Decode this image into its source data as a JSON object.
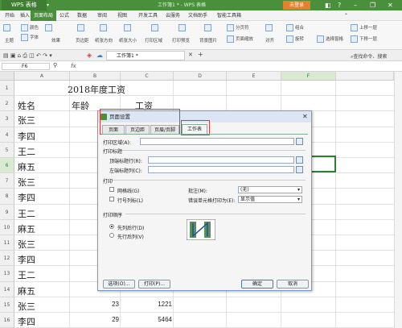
{
  "app": {
    "brand": "WPS 表格",
    "window_title": "工作簿1 * - WPS 表格",
    "login_button": "未登录"
  },
  "menu": [
    "开始",
    "插入",
    "页面布局",
    "公式",
    "数据",
    "审阅",
    "视图",
    "开发工具",
    "云服务",
    "文档助手",
    "智能工具箱"
  ],
  "menu_active_index": 2,
  "ribbon": {
    "items": [
      "主题",
      "颜色",
      "字体",
      "效果",
      "页边距",
      "纸张方向",
      "纸张大小",
      "打印区域",
      "打印预览",
      "背景图片",
      "分页符",
      "页面缩放",
      "对齐",
      "旋转",
      "组合",
      "选择窗格",
      "上移一层",
      "下移一层"
    ]
  },
  "doc_tab": "工作簿1 *",
  "search_placeholder": "查找命令、搜索",
  "formula_bar": {
    "cell_ref": "F6",
    "fx": "fx"
  },
  "columns": [
    "A",
    "B",
    "C",
    "D",
    "E",
    "F"
  ],
  "rows": [
    "1",
    "2",
    "3",
    "4",
    "5",
    "6",
    "7",
    "8",
    "9",
    "10",
    "11",
    "12",
    "13",
    "14",
    "15",
    "16"
  ],
  "sheet": {
    "title": "2018年度工资",
    "headers": [
      "姓名",
      "年龄",
      "工资"
    ],
    "names": [
      "张三",
      "李四",
      "王二",
      "麻五",
      "张三",
      "李四",
      "王二",
      "麻五",
      "张三",
      "李四",
      "王二",
      "麻五",
      "张三",
      "李四"
    ],
    "ages": [
      "23",
      "29"
    ],
    "salaries": [
      "1221",
      "5464"
    ]
  },
  "dialog": {
    "title": "页面设置",
    "tabs": [
      "页面",
      "页边距",
      "页眉/页脚",
      "工作表"
    ],
    "print_area_label": "打印区域(A):",
    "print_titles_label": "打印标题",
    "top_rows_label": "顶端标题行(R):",
    "left_cols_label": "左端标题列(C):",
    "print_section_label": "打印",
    "gridlines_label": "网格线(G)",
    "row_col_headers_label": "行号列标(L)",
    "comments_label": "批注(M):",
    "comments_value": "(无)",
    "errors_label": "错误单元格打印为(E):",
    "errors_value": "显示值",
    "order_label": "打印顺序",
    "down_then_over": "先列后行(D)",
    "over_then_down": "先行后列(V)",
    "options_button": "选项(O)...",
    "print_button": "打印(P)...",
    "ok_button": "确定",
    "cancel_button": "取消"
  },
  "colors": {
    "accent": "#4a8f3c",
    "highlight": "#e03a3a"
  }
}
